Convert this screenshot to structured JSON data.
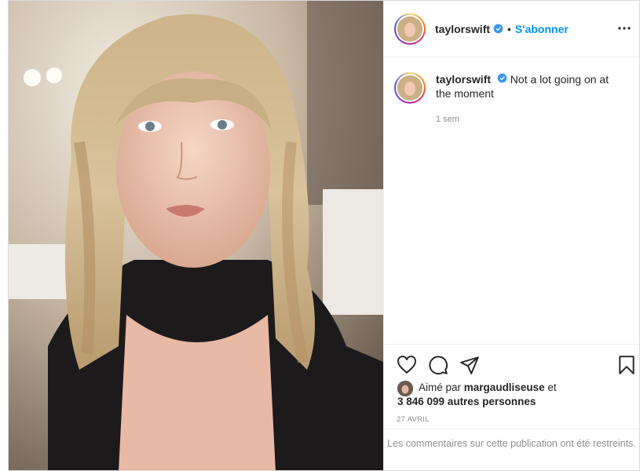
{
  "post": {
    "username": "taylorswift",
    "follow_label": "S'abonner",
    "separator": "•",
    "caption_text": "Not a lot going on at the moment",
    "caption_time": "1 sem",
    "liked_prefix": "Aimé par",
    "liked_user": "margaudliseuse",
    "liked_and": "et",
    "liked_others": "3 846 099 autres personnes",
    "date": "27 AVRIL",
    "comments_restricted": "Les commentaires sur cette publication ont été restreints.",
    "icons": [
      "verified-badge-icon",
      "more-options-icon",
      "heart-icon",
      "comment-icon",
      "share-icon",
      "bookmark-icon"
    ],
    "colors": {
      "accent": "#0095f6",
      "text": "#262626",
      "muted": "#8e8e8e",
      "border": "#dbdbdb"
    }
  }
}
